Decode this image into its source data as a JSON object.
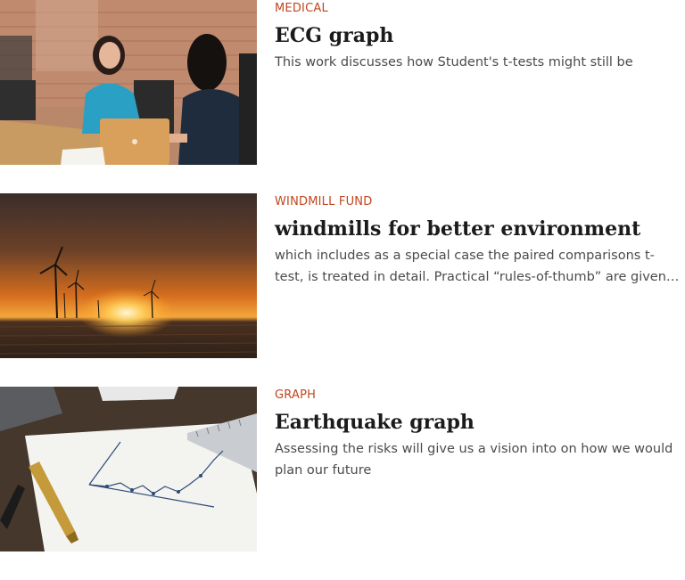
{
  "articles": [
    {
      "category": "MEDICAL",
      "title": "ECG graph",
      "excerpt": "This work discusses how Student's t-tests might still be",
      "image_icon": "meeting-photo",
      "accent_color": "#c0461e"
    },
    {
      "category": "WINDMILL FUND",
      "title": "windmills for better environment",
      "excerpt": "which includes as a special case the paired comparisons t-test, is treated in detail. Practical “rules-of-thumb” are given, with",
      "image_icon": "windmill-sunset-photo",
      "accent_color": "#c0461e"
    },
    {
      "category": "GRAPH",
      "title": "Earthquake graph",
      "excerpt": "Assessing the risks will give us a vision into on how we would plan our future",
      "image_icon": "graph-paper-photo",
      "accent_color": "#c0461e"
    }
  ]
}
